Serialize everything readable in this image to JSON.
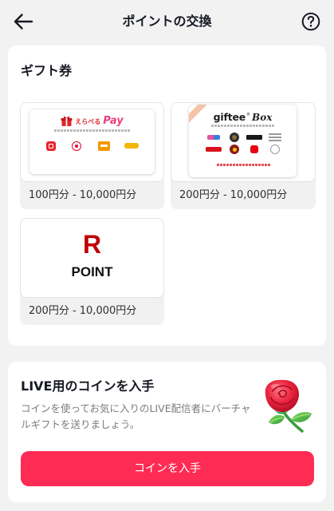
{
  "header": {
    "title": "ポイントの交換",
    "back_icon": "arrow-left-icon",
    "help_icon": "question-circle-icon"
  },
  "gift_section": {
    "title": "ギフト券",
    "cards": [
      {
        "logo": {
          "word": "えらべる",
          "pay": "Pay"
        },
        "range": "100円分 - 10,000円分"
      },
      {
        "logo": {
          "word": "giftee",
          "mark": "®",
          "box": "Box"
        },
        "range": "200円分 - 10,000円分"
      },
      {
        "logo": {
          "mark": "R",
          "word": "POINT"
        },
        "range": "200円分 - 10,000円分"
      }
    ]
  },
  "coin_section": {
    "title": "LIVE用のコインを入手",
    "description": "コインを使ってお気に入りのLIVE配信者にバーチャルギフトを送りましょう。",
    "button_label": "コインを入手",
    "image_icon": "rose-icon"
  },
  "icons": {
    "back": "arrow-left-icon",
    "help": "question-circle-icon",
    "gift": "gift-icon",
    "rose": "rose-icon"
  },
  "colors": {
    "page_background": "#f2f2f2",
    "card_background": "#ffffff",
    "primary_text": "#161823",
    "secondary_text": "#7b7b80",
    "accent": "#fe2c55",
    "rakuten_red": "#bf0000"
  }
}
